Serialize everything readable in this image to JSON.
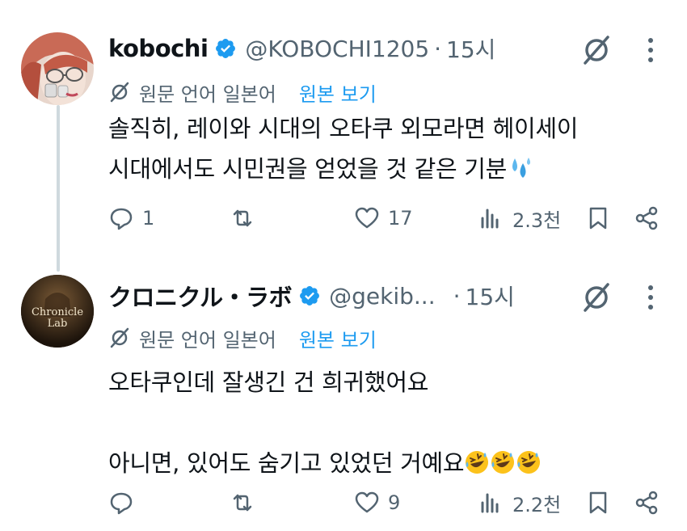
{
  "tweets": [
    {
      "name": "kobochi",
      "handle": "@KOBOCHI1205",
      "separator": "·",
      "time": "15시",
      "avatar_icon": "avatar-woman-glasses",
      "translation": {
        "label": "원문 언어 일본어",
        "link": "원본 보기"
      },
      "lines": [
        "솔직히, 레이와 시대의 오타쿠 외모라면 헤이세이",
        "시대에서도 시민권을 얻었을 것 같은 기분"
      ],
      "emoji": [
        "sweat-droplets"
      ],
      "actions": {
        "replies": "1",
        "retweets": "",
        "likes": "17",
        "views": "2.3천"
      }
    },
    {
      "name": "クロニクル・ラボ",
      "handle": "@gekib...",
      "separator": "·",
      "time": "15시",
      "avatar_icon": "avatar-chronicle-lab",
      "avatar_text": [
        "Chronicle",
        "Lab"
      ],
      "translation": {
        "label": "원문 언어 일본어",
        "link": "원본 보기"
      },
      "lines": [
        "오타쿠인데 잘생긴 건 희귀했어요",
        "",
        "아니면, 있어도 숨기고 있었던 거예요"
      ],
      "emoji": [
        "rolling-on-floor-laughing",
        "rolling-on-floor-laughing",
        "rolling-on-floor-laughing"
      ],
      "actions": {
        "replies": "",
        "retweets": "",
        "likes": "9",
        "views": "2.2천"
      }
    }
  ],
  "colors": {
    "verified": "#1d9bf0",
    "link": "#1d9bf0",
    "muted": "#536471",
    "thread": "#cfd9de"
  }
}
